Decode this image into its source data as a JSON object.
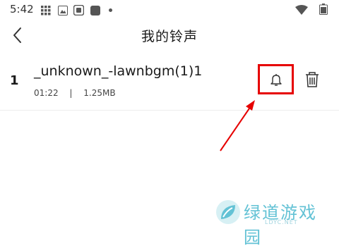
{
  "status_bar": {
    "time": "5:42",
    "icons": [
      "grid-icon",
      "photo-icon",
      "ram-icon",
      "app-icon",
      "dot-icon",
      "wifi-icon",
      "battery-icon"
    ]
  },
  "header": {
    "title": "我的铃声",
    "back_icon": "chevron-left-icon"
  },
  "ringtones": [
    {
      "index": "1",
      "name": "_unknown_-lawnbgm(1)1",
      "duration": "01:22",
      "separator": "|",
      "size": "1.25MB"
    }
  ],
  "colors": {
    "highlight": "#e60000",
    "watermark": "#63c2d5"
  },
  "watermark": {
    "text": "绿道游戏园",
    "subtext": "LDYC.NET"
  }
}
